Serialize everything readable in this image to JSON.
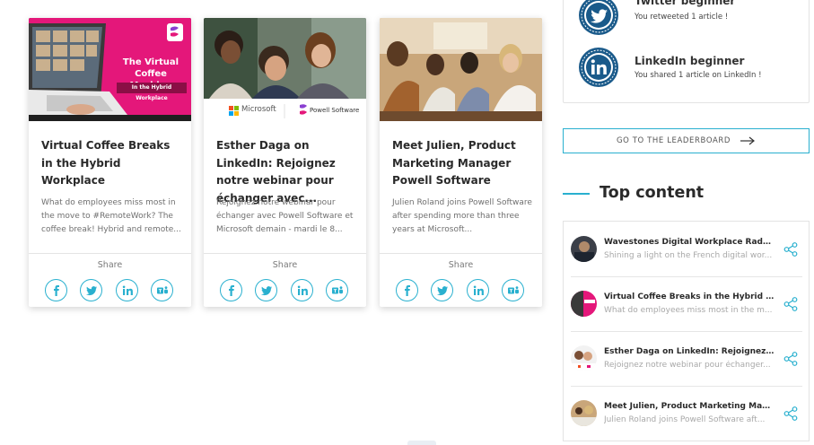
{
  "cards": [
    {
      "title": "Virtual Coffee Breaks in the Hybrid Workplace",
      "excerpt": "What do employees miss most in the move to #RemoteWork? The coffee break! Hybrid and remote...",
      "share_label": "Share",
      "image": {
        "banner_title": "The Virtual Coffee Machine",
        "banner_subtitle": "In the Hybrid Workplace",
        "accent": "#e4177a"
      }
    },
    {
      "title": "Esther Daga on LinkedIn: Rejoignez notre webinar pour échanger avec...",
      "excerpt": "Rejoignez notre webinar pour échanger avec Powell Software et Microsoft demain - mardi le 8...",
      "share_label": "Share",
      "image": {
        "logo1": "Microsoft",
        "logo2": "Powell Software"
      }
    },
    {
      "title": "Meet Julien, Product Marketing Manager Powell Software",
      "excerpt": "Julien Roland joins Powell Software after spending more than three years at Microsoft...",
      "share_label": "Share"
    }
  ],
  "share_icons": [
    "facebook-icon",
    "twitter-icon",
    "linkedin-icon",
    "teams-icon"
  ],
  "badges": [
    {
      "title": "Twitter beginner",
      "desc": "You retweeted 1 article !",
      "icon": "twitter-badge-icon"
    },
    {
      "title": "LinkedIn beginner",
      "desc": "You shared 1 article on LinkedIn !",
      "icon": "linkedin-badge-icon"
    }
  ],
  "leaderboard": {
    "label": "GO TO THE LEADERBOARD"
  },
  "top_content": {
    "heading": "Top content",
    "items": [
      {
        "title": "Wavestones Digital Workplace Radar n...",
        "sub": "Shining a light on the French digital wor..."
      },
      {
        "title": "Virtual Coffee Breaks in the Hybrid Wo...",
        "sub": "What do employees miss most in the m..."
      },
      {
        "title": "Esther Daga on LinkedIn: Rejoignez no...",
        "sub": "Rejoignez notre webinar pour échanger..."
      },
      {
        "title": "Meet Julien, Product Marketing Manag...",
        "sub": "Julien Roland joins Powell Software aft..."
      }
    ]
  },
  "colors": {
    "accent": "#29b0cf",
    "badge_blue": "#1a5a8a",
    "pink": "#e4177a"
  }
}
